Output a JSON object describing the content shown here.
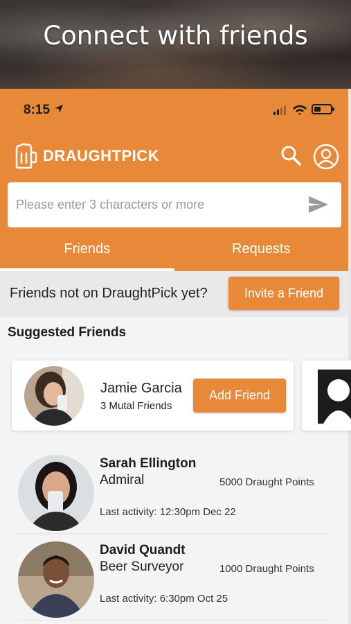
{
  "promo": {
    "title": "Connect with friends"
  },
  "status_bar": {
    "time": "8:15"
  },
  "app": {
    "brand": "DRAUGHTPICK"
  },
  "search": {
    "placeholder": "Please enter 3 characters or more"
  },
  "tabs": [
    {
      "label": "Friends",
      "active": true
    },
    {
      "label": "Requests",
      "active": false
    }
  ],
  "invite": {
    "text": "Friends not on DraughtPick yet?",
    "button_label": "Invite a Friend"
  },
  "suggested": {
    "title": "Suggested Friends",
    "cards": [
      {
        "name": "Jamie Garcia",
        "mutual": "3 Mutal Friends",
        "button_label": "Add Friend"
      }
    ]
  },
  "friends": [
    {
      "name": "Sarah Ellington",
      "rank": "Admiral",
      "points": "5000 Draught Points",
      "activity": "Last activity: 12:30pm Dec 22"
    },
    {
      "name": "David Quandt",
      "rank": "Beer Surveyor",
      "points": "1000 Draught Points",
      "activity": "Last activity: 6:30pm Oct 25"
    }
  ],
  "colors": {
    "accent": "#e8893a",
    "background": "#f4f4f4",
    "invite_bar": "#e9e9e9"
  },
  "icons": [
    "location-arrow-icon",
    "signal-icon",
    "wifi-icon",
    "battery-icon",
    "beer-mug-logo-icon",
    "search-icon",
    "profile-icon",
    "send-icon"
  ]
}
